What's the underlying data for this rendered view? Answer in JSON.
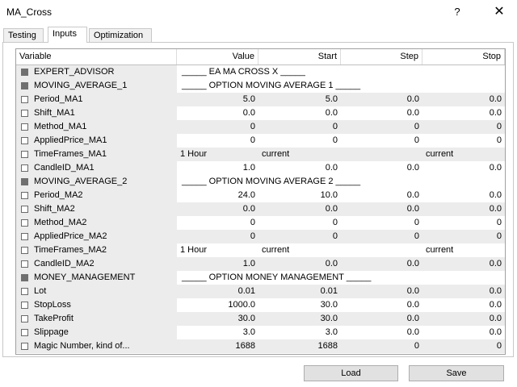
{
  "window": {
    "title": "MA_Cross",
    "help": "?",
    "close": "✕"
  },
  "tabs": [
    "Testing",
    "Inputs",
    "Optimization"
  ],
  "columns": [
    "Variable",
    "Value",
    "Start",
    "Step",
    "Stop"
  ],
  "rows": [
    {
      "type": "section",
      "name": "EXPERT_ADVISOR",
      "text": "_____ EA MA CROSS X _____"
    },
    {
      "type": "section",
      "name": "MOVING_AVERAGE_1",
      "text": "_____ OPTION MOVING AVERAGE 1 _____"
    },
    {
      "type": "param",
      "name": "Period_MA1",
      "value": "5.0",
      "start": "5.0",
      "step": "0.0",
      "stop": "0.0"
    },
    {
      "type": "param",
      "name": "Shift_MA1",
      "value": "0.0",
      "start": "0.0",
      "step": "0.0",
      "stop": "0.0"
    },
    {
      "type": "param",
      "name": "Method_MA1",
      "value": "0",
      "start": "0",
      "step": "0",
      "stop": "0"
    },
    {
      "type": "param",
      "name": "AppliedPrice_MA1",
      "value": "0",
      "start": "0",
      "step": "0",
      "stop": "0"
    },
    {
      "type": "tf",
      "name": "TimeFrames_MA1",
      "value": "1 Hour",
      "start": "current",
      "step": "",
      "stop": "current"
    },
    {
      "type": "param",
      "name": "CandleID_MA1",
      "value": "1.0",
      "start": "0.0",
      "step": "0.0",
      "stop": "0.0"
    },
    {
      "type": "section",
      "name": "MOVING_AVERAGE_2",
      "text": "_____ OPTION MOVING AVERAGE 2 _____"
    },
    {
      "type": "param",
      "name": "Period_MA2",
      "value": "24.0",
      "start": "10.0",
      "step": "0.0",
      "stop": "0.0"
    },
    {
      "type": "param",
      "name": "Shift_MA2",
      "value": "0.0",
      "start": "0.0",
      "step": "0.0",
      "stop": "0.0"
    },
    {
      "type": "param",
      "name": "Method_MA2",
      "value": "0",
      "start": "0",
      "step": "0",
      "stop": "0"
    },
    {
      "type": "param",
      "name": "AppliedPrice_MA2",
      "value": "0",
      "start": "0",
      "step": "0",
      "stop": "0"
    },
    {
      "type": "tf",
      "name": "TimeFrames_MA2",
      "value": "1 Hour",
      "start": "current",
      "step": "",
      "stop": "current"
    },
    {
      "type": "param",
      "name": "CandleID_MA2",
      "value": "1.0",
      "start": "0.0",
      "step": "0.0",
      "stop": "0.0"
    },
    {
      "type": "section",
      "name": "MONEY_MANAGEMENT",
      "text": "_____ OPTION MONEY MANAGEMENT _____"
    },
    {
      "type": "param",
      "name": "Lot",
      "value": "0.01",
      "start": "0.01",
      "step": "0.0",
      "stop": "0.0"
    },
    {
      "type": "param",
      "name": "StopLoss",
      "value": "1000.0",
      "start": "30.0",
      "step": "0.0",
      "stop": "0.0"
    },
    {
      "type": "param",
      "name": "TakeProfit",
      "value": "30.0",
      "start": "30.0",
      "step": "0.0",
      "stop": "0.0"
    },
    {
      "type": "param",
      "name": "Slippage",
      "value": "3.0",
      "start": "3.0",
      "step": "0.0",
      "stop": "0.0"
    },
    {
      "type": "param",
      "name": "Magic Number, kind of...",
      "value": "1688",
      "start": "1688",
      "step": "0",
      "stop": "0"
    }
  ],
  "buttons": {
    "load": "Load",
    "save": "Save"
  }
}
